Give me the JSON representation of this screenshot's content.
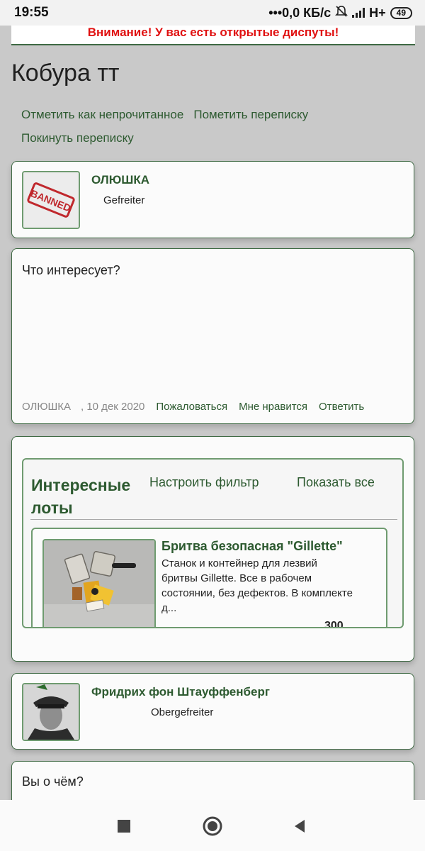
{
  "status_bar": {
    "time": "19:55",
    "net_speed": "•••0,0 КБ/с",
    "network": "H+",
    "battery": "49",
    "icons": [
      "mute-bell-icon",
      "signal-icon",
      "battery-icon"
    ]
  },
  "alert": {
    "text": "Внимание! У вас есть открытые диспуты!",
    "color": "#e01010"
  },
  "page": {
    "title": "Кобура тт",
    "actions": [
      "Отметить как непрочитанное",
      "Пометить переписку",
      "Покинуть переписку"
    ]
  },
  "post1": {
    "author": {
      "name": "ОЛЮШКА",
      "rank": "Gefreiter",
      "avatar_stamp": "BANNED"
    }
  },
  "message": {
    "text": "Что интересует?",
    "author": "ОЛЮШКА",
    "date": ", 10 дек 2020",
    "actions": {
      "report": "Пожаловаться",
      "like": "Мне нравится",
      "reply": "Ответить"
    }
  },
  "lots": {
    "title": "Интересные лоты",
    "filter_label": "Настроить фильтр",
    "show_all_label": "Показать все",
    "item": {
      "title": "Бритва безопасная \"Gillette\"",
      "description": "Станок и контейнер для лезвий бритвы Gillette. Все в рабочем состоянии, без дефектов. В комплекте д...",
      "price_partial": "300"
    }
  },
  "post2": {
    "author": {
      "name": "Фридрих фон Штауффенберг",
      "rank": "Obergefreiter"
    }
  },
  "reply_box": {
    "placeholder": "Вы о чём?"
  },
  "nav": {
    "icons": [
      "recent-apps-icon",
      "home-icon",
      "back-icon"
    ]
  },
  "colors": {
    "accent": "#2d5a30",
    "background": "#c9c9c9",
    "card": "#fbfbfb",
    "alert": "#e01010"
  }
}
